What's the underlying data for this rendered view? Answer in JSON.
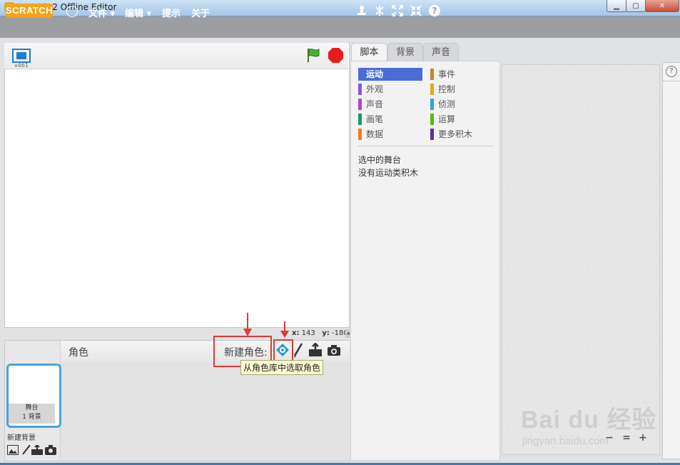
{
  "window": {
    "title": "Scratch 2 Offline Editor",
    "min_label": "▁",
    "max_label": "▢",
    "close_label": "✕"
  },
  "menubar": {
    "logo_text": "SCRATCH",
    "items": [
      "文件 ▾",
      "编辑 ▾",
      "提示",
      "关于"
    ],
    "tool_icons": [
      "duplicate-icon",
      "delete-icon",
      "grow-icon",
      "shrink-icon",
      "help-icon"
    ]
  },
  "stage": {
    "version": "v461",
    "x_label": "x:",
    "x_value": "143",
    "y_label": "y:",
    "y_value": "-180"
  },
  "sprites": {
    "title": "角色",
    "new_sprite_label": "新建角色:",
    "tooltip": "从角色库中选取角色",
    "stage_thumb_name": "舞台",
    "stage_thumb_count": "1 背景",
    "new_backdrop_label": "新建背景"
  },
  "tabs": [
    "脚本",
    "背景",
    "声音"
  ],
  "categories": {
    "left": [
      {
        "label": "运动",
        "color": "#4a6cd4"
      },
      {
        "label": "外观",
        "color": "#8a55d7"
      },
      {
        "label": "声音",
        "color": "#bb42c3"
      },
      {
        "label": "画笔",
        "color": "#0e9a6c"
      },
      {
        "label": "数据",
        "color": "#ee7d16"
      }
    ],
    "right": [
      {
        "label": "事件",
        "color": "#c88330"
      },
      {
        "label": "控制",
        "color": "#e1a91a"
      },
      {
        "label": "侦测",
        "color": "#2ca5e2"
      },
      {
        "label": "运算",
        "color": "#5cb712"
      },
      {
        "label": "更多积木",
        "color": "#632d99"
      }
    ]
  },
  "palette": {
    "message_1": "选中的舞台",
    "message_2": "没有运动类积木"
  },
  "help_label": "?",
  "zoom": {
    "zoom_out": "−",
    "reset": "=",
    "zoom_in": "+"
  },
  "watermark": {
    "brand": "Bai du 经验",
    "sub": "jingyan.baidu.com"
  }
}
